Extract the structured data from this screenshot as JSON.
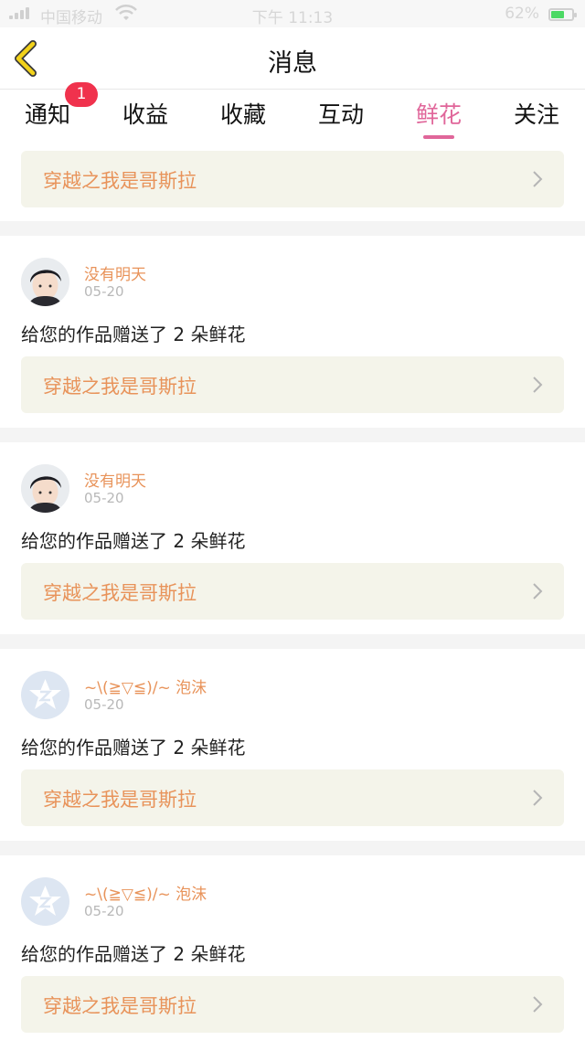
{
  "status_bar": {
    "carrier": "中国移动",
    "time": "下午 11:13",
    "battery": "62%",
    "battery_level": 0.62
  },
  "header": {
    "title": "消息",
    "back_icon": "chevron-left-icon"
  },
  "tabs": [
    {
      "label": "通知",
      "active": false,
      "badge": "1"
    },
    {
      "label": "收益",
      "active": false
    },
    {
      "label": "收藏",
      "active": false
    },
    {
      "label": "互动",
      "active": false
    },
    {
      "label": "鲜花",
      "active": true
    },
    {
      "label": "关注",
      "active": false
    }
  ],
  "colors": {
    "accent": "#e0669a",
    "badge": "#f0324d",
    "username": "#e8935a",
    "book_title": "#e8935a",
    "card_bg": "#f4f4ea",
    "back_arrow": "#f2d21a"
  },
  "top_card": {
    "book_title": "穿越之我是哥斯拉"
  },
  "messages": [
    {
      "avatar": "boy-photo",
      "username": "没有明天",
      "date": "05-20",
      "text": "给您的作品赠送了 2 朵鲜花",
      "book_title": "穿越之我是哥斯拉"
    },
    {
      "avatar": "boy-photo",
      "username": "没有明天",
      "date": "05-20",
      "text": "给您的作品赠送了 2 朵鲜花",
      "book_title": "穿越之我是哥斯拉"
    },
    {
      "avatar": "default-star-avatar",
      "username": "~\\(≧▽≦)/~ 泡沫",
      "date": "05-20",
      "text": "给您的作品赠送了 2 朵鲜花",
      "book_title": "穿越之我是哥斯拉"
    },
    {
      "avatar": "default-star-avatar",
      "username": "~\\(≧▽≦)/~ 泡沫",
      "date": "05-20",
      "text": "给您的作品赠送了 2 朵鲜花",
      "book_title": "穿越之我是哥斯拉"
    }
  ]
}
